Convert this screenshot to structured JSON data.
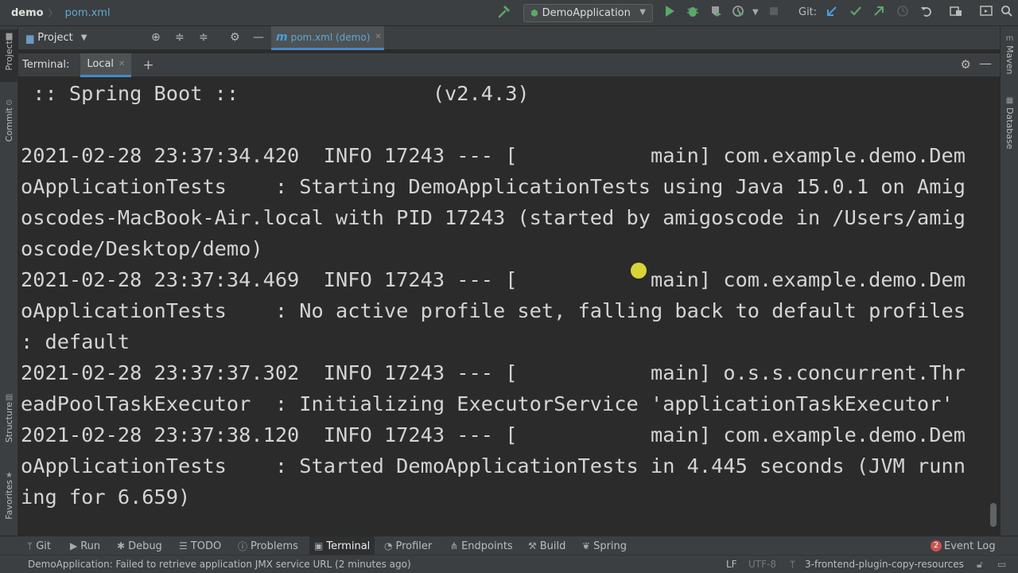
{
  "nav": {
    "project": "demo",
    "file": "pom.xml",
    "run_config": "DemoApplication",
    "git_label": "Git:"
  },
  "left_tabs": {
    "project": "Project",
    "commit": "Commit",
    "structure": "Structure",
    "favorites": "Favorites"
  },
  "right_tabs": {
    "maven": "Maven",
    "database": "Database"
  },
  "project_panel": {
    "title": "Project"
  },
  "editor": {
    "tab": "pom.xml (demo)"
  },
  "terminal": {
    "label": "Terminal:",
    "tab": "Local",
    "lines": [
      " :: Spring Boot ::                (v2.4.3)",
      "",
      "2021-02-28 23:37:34.420  INFO 17243 --- [           main] com.example.demo.Dem",
      "oApplicationTests    : Starting DemoApplicationTests using Java 15.0.1 on Amig",
      "oscodes-MacBook-Air.local with PID 17243 (started by amigoscode in /Users/amig",
      "oscode/Desktop/demo)",
      "2021-02-28 23:37:34.469  INFO 17243 --- [           main] com.example.demo.Dem",
      "oApplicationTests    : No active profile set, falling back to default profiles",
      ": default",
      "2021-02-28 23:37:37.302  INFO 17243 --- [           main] o.s.s.concurrent.Thr",
      "eadPoolTaskExecutor  : Initializing ExecutorService 'applicationTaskExecutor'",
      "2021-02-28 23:37:38.120  INFO 17243 --- [           main] com.example.demo.Dem",
      "oApplicationTests    : Started DemoApplicationTests in 4.445 seconds (JVM runn",
      "ing for 6.659)"
    ]
  },
  "tool_windows": {
    "git": "Git",
    "run": "Run",
    "debug": "Debug",
    "todo": "TODO",
    "problems": "Problems",
    "terminal": "Terminal",
    "profiler": "Profiler",
    "endpoints": "Endpoints",
    "build": "Build",
    "spring": "Spring",
    "event_log": "Event Log",
    "event_log_count": "2"
  },
  "status": {
    "message": "DemoApplication: Failed to retrieve application JMX service URL (2 minutes ago)",
    "line_sep": "LF",
    "encoding": "UTF-8",
    "branch": "3-frontend-plugin-copy-resources"
  },
  "colors": {
    "background": "#2b2b2b",
    "panel": "#3c3f41",
    "accent": "#4a88c7",
    "run_green": "#59a869",
    "badge_red": "#c75450",
    "cursor_yellow": "#e7e33a"
  },
  "icons": [
    "hammer-icon",
    "run-icon",
    "debug-icon",
    "coverage-icon",
    "profile-icon",
    "stop-icon",
    "git-update-icon",
    "git-commit-icon",
    "git-push-icon",
    "history-icon",
    "rollback-icon",
    "project-structure-icon",
    "search-icon",
    "gear-icon",
    "minimize-icon"
  ]
}
